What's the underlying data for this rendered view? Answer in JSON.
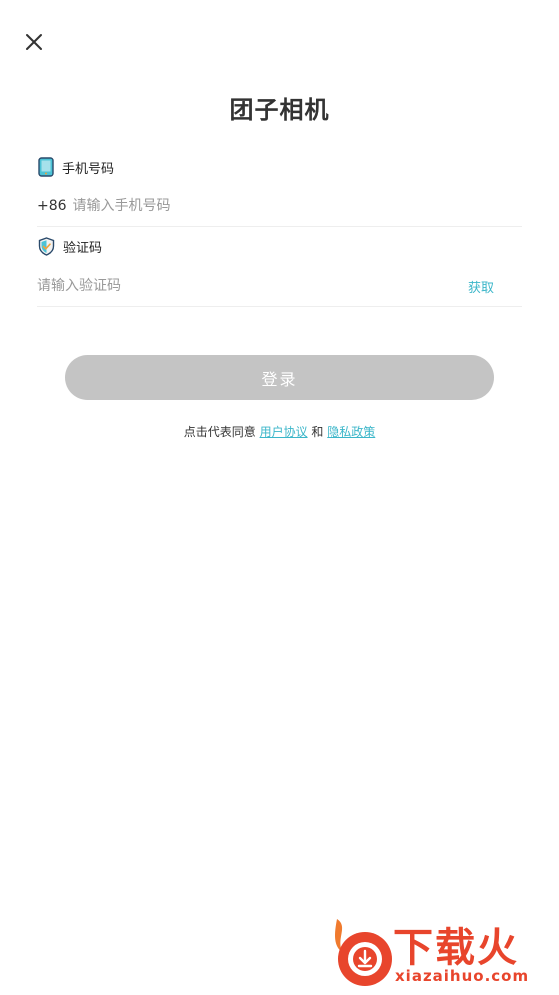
{
  "header": {
    "title": "团子相机"
  },
  "phone": {
    "label": "手机号码",
    "prefix": "+86",
    "placeholder": "请输入手机号码",
    "icon": "phone-icon"
  },
  "code": {
    "label": "验证码",
    "placeholder": "请输入验证码",
    "get_code_label": "获取",
    "icon": "shield-check-icon"
  },
  "login": {
    "label": "登录"
  },
  "agreement": {
    "prefix": "点击代表同意",
    "user_agreement": "用户协议",
    "and": "和",
    "privacy_policy": "隐私政策"
  },
  "watermark": {
    "text": "下载火",
    "url": "xiazaihuo.com"
  },
  "colors": {
    "accent": "#3bb6c9",
    "button_disabled": "#c4c4c4",
    "watermark": "#e8452c"
  }
}
